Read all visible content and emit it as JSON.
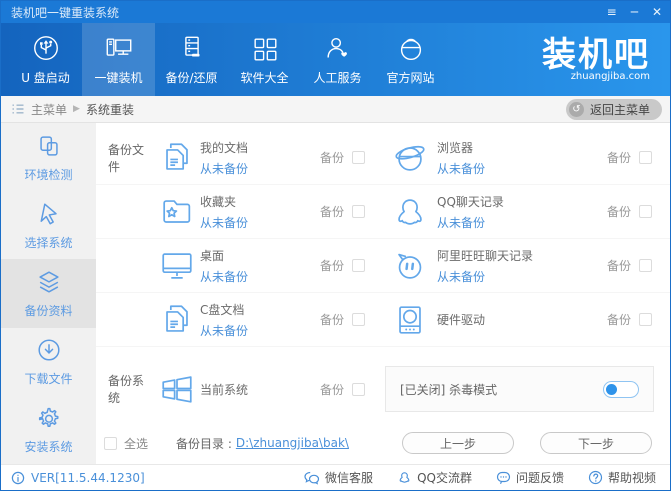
{
  "window": {
    "title": "装机吧一键重装系统"
  },
  "titlebar": {
    "menu": "≡",
    "minimize": "─",
    "close": "✕"
  },
  "header": {
    "nav": [
      {
        "label": "U 盘启动",
        "icon": "usb-icon"
      },
      {
        "label": "一键装机",
        "icon": "computer-icon",
        "active": true
      },
      {
        "label": "备份/还原",
        "icon": "backup-restore-icon"
      },
      {
        "label": "软件大全",
        "icon": "software-grid-icon"
      },
      {
        "label": "人工服务",
        "icon": "support-person-icon"
      },
      {
        "label": "官方网站",
        "icon": "website-globe-icon"
      }
    ],
    "logo": {
      "brand": "装机吧",
      "domain": "zhuangjiba.com"
    }
  },
  "breadcrumb": {
    "root": "主菜单",
    "separator": "▶",
    "current": "系统重装",
    "back_button": "返回主菜单",
    "back_icon": "↺"
  },
  "sidebar": {
    "items": [
      {
        "label": "环境检测",
        "icon": "environment-check-icon"
      },
      {
        "label": "选择系统",
        "icon": "select-system-icon"
      },
      {
        "label": "备份资料",
        "icon": "backup-data-icon",
        "active": true
      },
      {
        "label": "下载文件",
        "icon": "download-files-icon"
      },
      {
        "label": "安装系统",
        "icon": "install-system-icon"
      }
    ]
  },
  "main": {
    "section_files": "备份文件",
    "section_system": "备份系统",
    "backup_label": "备份",
    "left_items": [
      {
        "name": "我的文档",
        "status": "从未备份",
        "icon": "documents-icon"
      },
      {
        "name": "收藏夹",
        "status": "从未备份",
        "icon": "favorites-folder-icon"
      },
      {
        "name": "桌面",
        "status": "从未备份",
        "icon": "desktop-monitor-icon"
      },
      {
        "name": "C盘文档",
        "status": "从未备份",
        "icon": "documents-icon"
      }
    ],
    "right_items": [
      {
        "name": "浏览器",
        "status": "从未备份",
        "icon": "browser-icon"
      },
      {
        "name": "QQ聊天记录",
        "status": "从未备份",
        "icon": "qq-icon"
      },
      {
        "name": "阿里旺旺聊天记录",
        "status": "从未备份",
        "icon": "wangwang-icon"
      },
      {
        "name": "硬件驱动",
        "status": "",
        "icon": "hardware-drive-icon"
      }
    ],
    "system_item": {
      "name": "当前系统",
      "status": "",
      "icon": "windows-icon"
    },
    "antivirus": {
      "label": "[已关闭] 杀毒模式",
      "state": "off"
    },
    "select_all_label": "全选",
    "backup_dir_label": "备份目录 :",
    "backup_dir_path": "D:\\zhuangjiba\\bak\\",
    "prev_button": "上一步",
    "next_button": "下一步"
  },
  "statusbar": {
    "version": "VER[11.5.44.1230]",
    "links": [
      {
        "label": "微信客服",
        "icon": "wechat-icon"
      },
      {
        "label": "QQ交流群",
        "icon": "qq-group-icon"
      },
      {
        "label": "问题反馈",
        "icon": "feedback-icon"
      },
      {
        "label": "帮助视频",
        "icon": "help-icon"
      }
    ]
  },
  "colors": {
    "titlebar": "#1b79d6",
    "header_gradient_start": "#1464be",
    "header_gradient_end": "#2a96ec",
    "link_blue": "#4a90d9",
    "icon_blue": "#63a8ea",
    "sidebar_bg": "#f1f1f1",
    "sidebar_active_bg": "#e3e3e3",
    "toggle_knob": "#2e93ea"
  }
}
